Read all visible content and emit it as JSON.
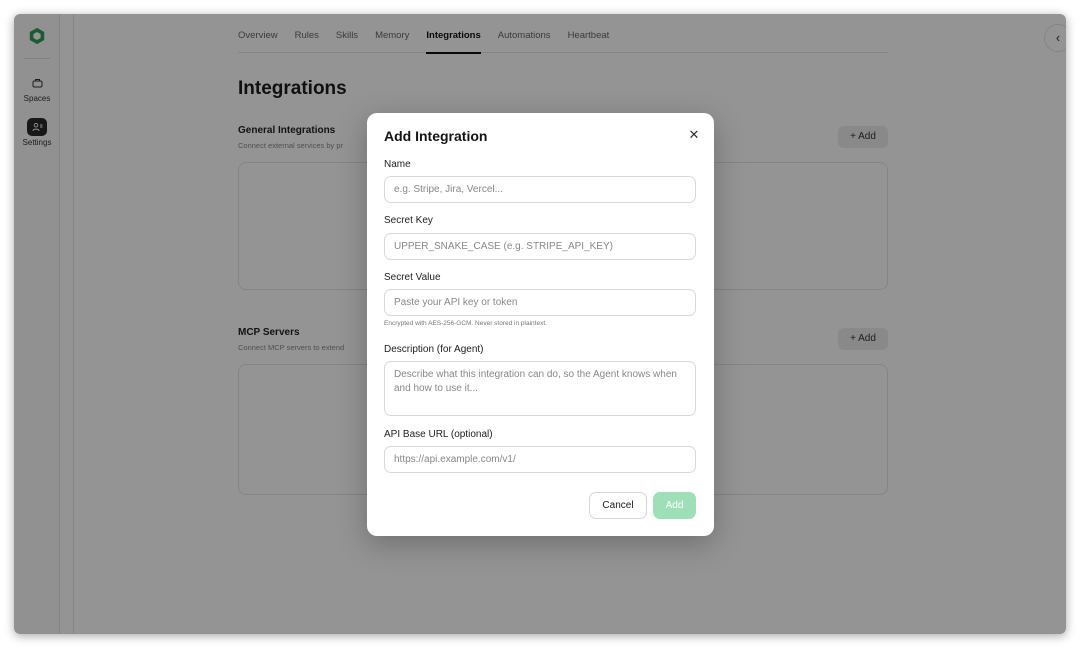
{
  "rail": {
    "spaces_label": "Spaces",
    "settings_label": "Settings"
  },
  "tabs": [
    {
      "label": "Overview",
      "active": false
    },
    {
      "label": "Rules",
      "active": false
    },
    {
      "label": "Skills",
      "active": false
    },
    {
      "label": "Memory",
      "active": false
    },
    {
      "label": "Integrations",
      "active": true
    },
    {
      "label": "Automations",
      "active": false
    },
    {
      "label": "Heartbeat",
      "active": false
    }
  ],
  "page": {
    "title": "Integrations",
    "general": {
      "title": "General Integrations",
      "desc": "Connect external services by pr",
      "add_label": "+ Add"
    },
    "mcp": {
      "title": "MCP Servers",
      "desc": "Connect MCP servers to extend",
      "add_label": "+ Add"
    }
  },
  "modal": {
    "title": "Add Integration",
    "close_icon": "close-icon",
    "name_label": "Name",
    "name_placeholder": "e.g. Stripe, Jira, Vercel...",
    "key_label": "Secret Key",
    "key_placeholder": "UPPER_SNAKE_CASE (e.g. STRIPE_API_KEY)",
    "value_label": "Secret Value",
    "value_placeholder": "Paste your API key or token",
    "encryption_hint": "Encrypted with AES-256-GCM. Never stored in plaintext.",
    "desc_label": "Description (for Agent)",
    "desc_placeholder": "Describe what this integration can do, so the Agent knows when and how to use it...",
    "url_label": "API Base URL (optional)",
    "url_placeholder": "https://api.example.com/v1/",
    "cancel_label": "Cancel",
    "add_label": "Add"
  },
  "colors": {
    "brand_green": "#2e9e5b",
    "add_button_disabled": "#9fdfb8"
  }
}
